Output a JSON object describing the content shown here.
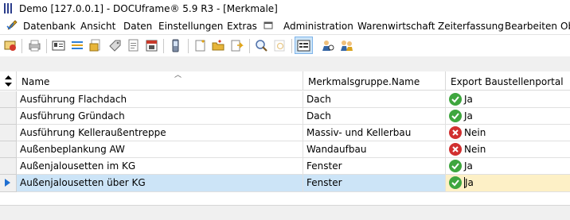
{
  "window": {
    "title": "Demo [127.0.0.1] - DOCUframe® 5.9 R3 - [Merkmale]"
  },
  "menu": {
    "items": [
      {
        "label": "Datenbank"
      },
      {
        "label": "Ansicht"
      },
      {
        "label": "Daten"
      },
      {
        "label": "Einstellungen"
      },
      {
        "label": "Extras"
      },
      {
        "label": "Administration"
      },
      {
        "label": "Warenwirtschaft"
      },
      {
        "label": "Zeiterfassung"
      },
      {
        "label": "Bearbeiten"
      },
      {
        "label": "Ob"
      }
    ]
  },
  "grid": {
    "columns": [
      {
        "label": "Name"
      },
      {
        "label": "Merkmalsgruppe.Name"
      },
      {
        "label": "Export Baustellenportal"
      }
    ],
    "rows": [
      {
        "name": "Ausführung Flachdach",
        "group": "Dach",
        "export": "Ja",
        "export_state": "yes"
      },
      {
        "name": "Ausführung Gründach",
        "group": "Dach",
        "export": "Ja",
        "export_state": "yes"
      },
      {
        "name": "Ausführung Kelleraußentreppe",
        "group": "Massiv- und Kellerbau",
        "export": "Nein",
        "export_state": "no"
      },
      {
        "name": "Außenbeplankung AW",
        "group": "Wandaufbau",
        "export": "Nein",
        "export_state": "no"
      },
      {
        "name": "Außenjalousetten im KG",
        "group": "Fenster",
        "export": "Ja",
        "export_state": "yes"
      },
      {
        "name": "Außenjalousetten über KG",
        "group": "Fenster",
        "export": "Ja",
        "export_state": "yes"
      }
    ],
    "selected_row": 5
  },
  "colors": {
    "selection": "#cce4f7",
    "edit_cell": "#fdf0c6",
    "yes": "#3ea63e",
    "no": "#d12f2f"
  }
}
